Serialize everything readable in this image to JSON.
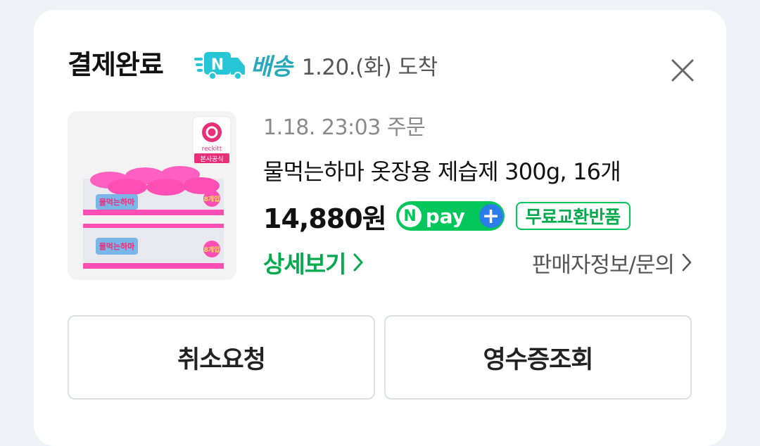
{
  "header": {
    "title": "결제완료",
    "delivery_badge": "N",
    "delivery_label": "배송",
    "delivery_date": "1.20.(화) 도착"
  },
  "product": {
    "order_date": "1.18. 23:03 주문",
    "name": "물먹는하마 옷장용 제습제 300g, 16개",
    "price": "14,880원",
    "npay_n": "N",
    "npay_text": "pay",
    "npay_plus": "+",
    "return_badge": "무료교환반품",
    "image": {
      "brand": "reckitt",
      "official_tag": "본사공식",
      "pack_label": "8개입",
      "product_label": "물먹는하마"
    }
  },
  "links": {
    "detail": "상세보기",
    "seller": "판매자정보/문의"
  },
  "buttons": {
    "cancel": "취소요청",
    "receipt": "영수증조회"
  },
  "colors": {
    "green": "#03c75a",
    "teal": "#27a9bd",
    "pink": "#ff4fb5",
    "npay_blue": "#2b7de9"
  },
  "icons": [
    "truck-icon",
    "close-icon",
    "chevron-right-icon",
    "npay-logo"
  ]
}
